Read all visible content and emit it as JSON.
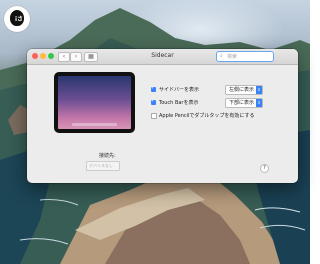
{
  "badge": {
    "text": "iさ"
  },
  "window": {
    "title": "Sidecar",
    "nav_back": "‹",
    "nav_forward": "›",
    "grid": "▦",
    "search": {
      "placeholder": "検索"
    }
  },
  "options": [
    {
      "label": "サイドバーを表示",
      "checked": true,
      "popup": "左側に表示"
    },
    {
      "label": "Touch Barを表示",
      "checked": true,
      "popup": "下部に表示"
    },
    {
      "label": "Apple Pencilでダブルタップを有効にする",
      "checked": false
    }
  ],
  "connect": {
    "label": "接続先:",
    "value": "デバイスなし"
  },
  "help_label": "?",
  "colors": {
    "accent": "#3b82f6",
    "window_bg": "#ececec",
    "traffic_red": "#fc605c",
    "traffic_yellow": "#fdbc40",
    "traffic_green": "#34c84a"
  },
  "icons": [
    "close-button",
    "minimize-button",
    "zoom-button",
    "back-icon",
    "forward-icon",
    "grid-icon",
    "search-icon",
    "help-icon"
  ]
}
